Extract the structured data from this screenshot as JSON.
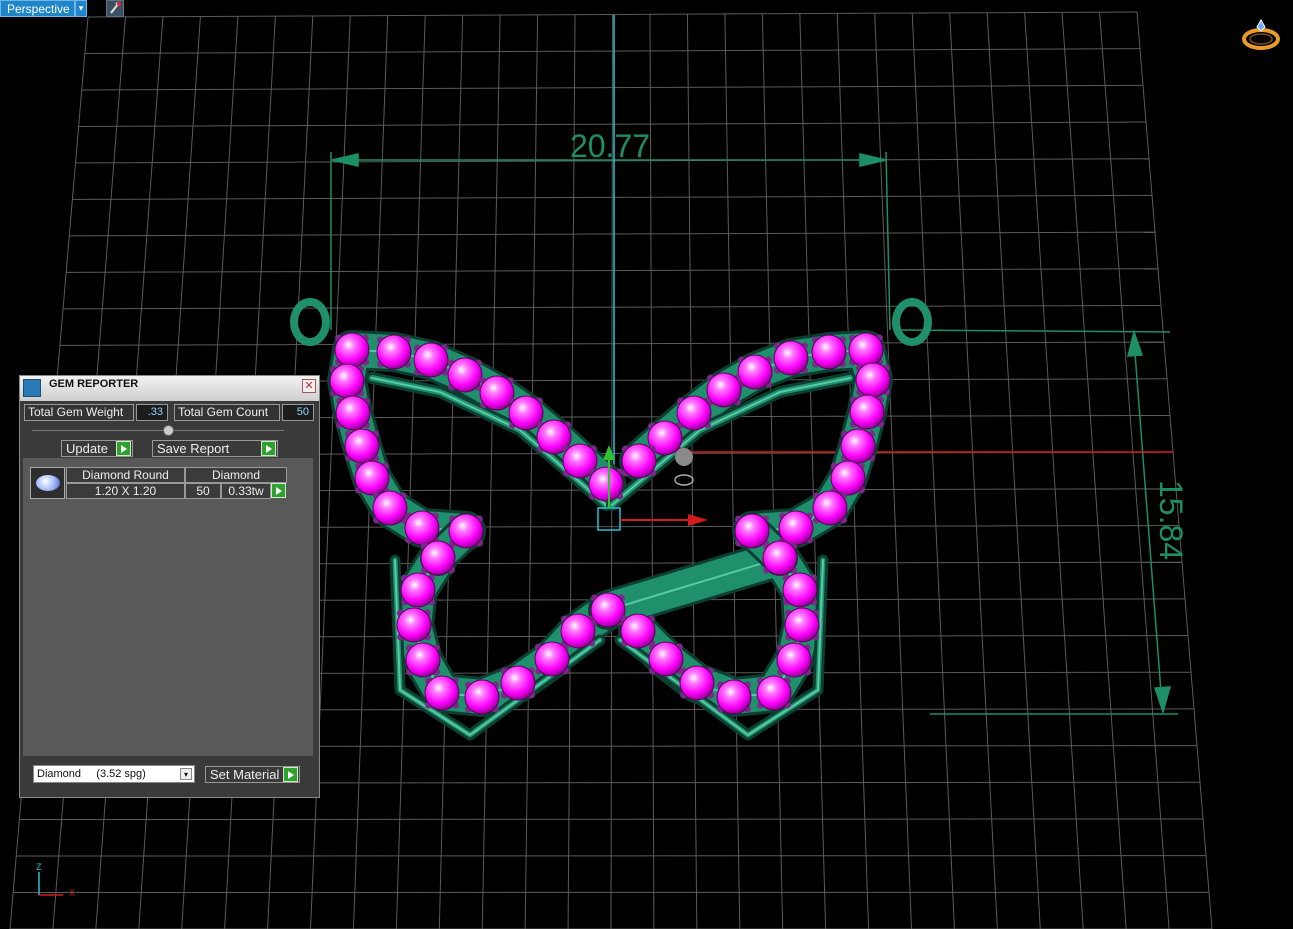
{
  "viewport": {
    "label": "Perspective",
    "dropdown_glyph": "▾",
    "dimension_horizontal": "20.77",
    "dimension_vertical": "15.84",
    "axis_z": "Z",
    "axis_x": "X",
    "top_right_icon": "ring-icon"
  },
  "gem_reporter": {
    "title": "GEM REPORTER",
    "close_glyph": "✕",
    "total_weight_label": "Total Gem Weight",
    "total_weight_value": ".33",
    "total_count_label": "Total Gem Count",
    "total_count_value": "50",
    "update_label": "Update",
    "save_report_label": "Save Report",
    "rows": [
      {
        "shape": "Diamond Round",
        "material": "Diamond",
        "size": "1.20 X 1.20",
        "count": "50",
        "weight": "0.33tw"
      }
    ],
    "material_select_value": "Diamond     (3.52 spg)",
    "select_arrow_glyph": "▾",
    "set_material_label": "Set Material"
  },
  "colors": {
    "gem": "#ff00ff",
    "metal": "#1f8f6c",
    "dimension": "#1c8f66",
    "grid": "#5b5b5b"
  }
}
